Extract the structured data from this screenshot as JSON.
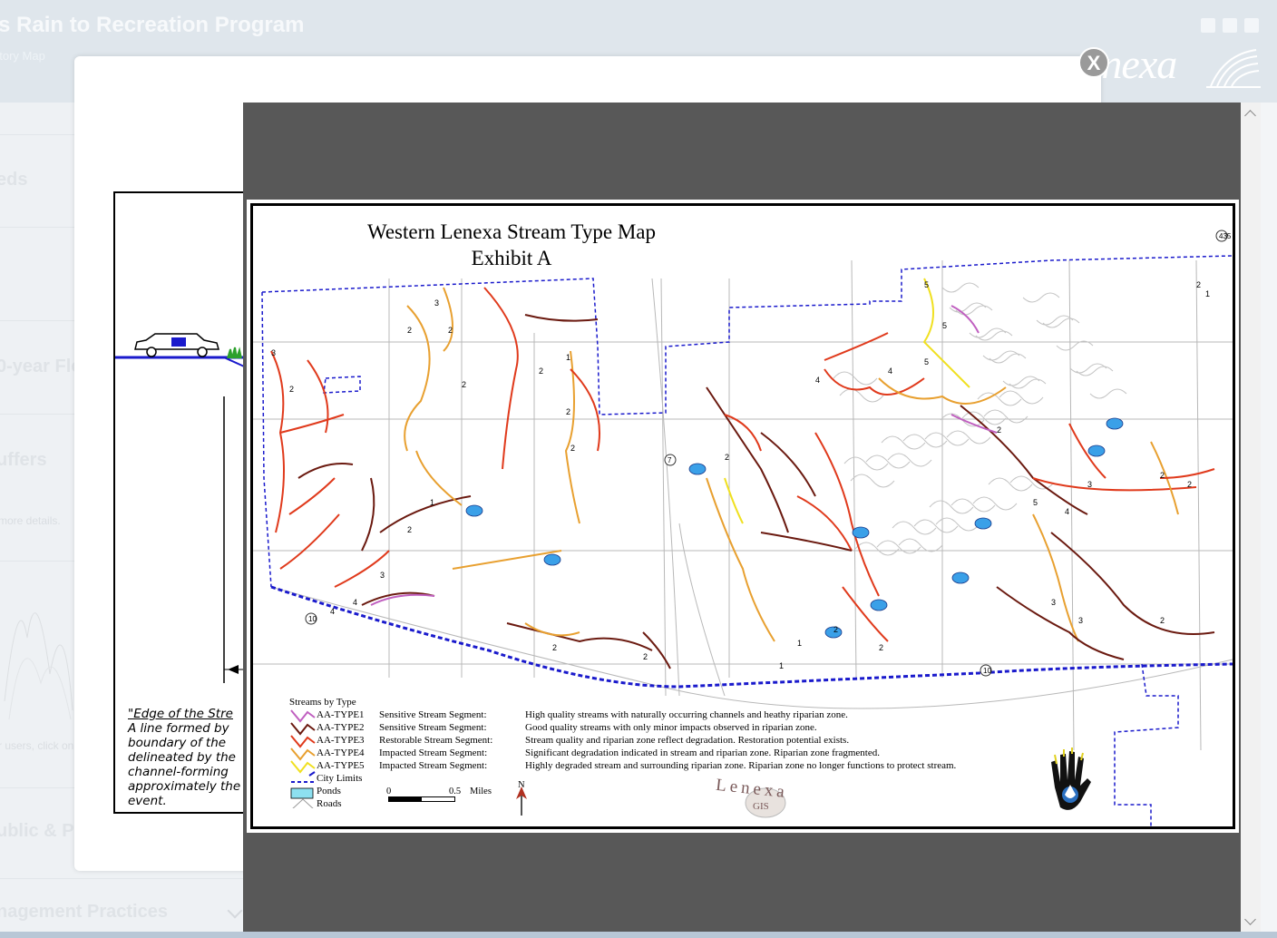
{
  "background": {
    "title": "s Rain to Recreation Program",
    "subtitle": "atory Map",
    "logo_text": "enexa",
    "sections": [
      "eds",
      "0-year Flo",
      "uffers",
      "ublic & P",
      "nagement Practices"
    ],
    "more_details": "more details.",
    "users_text": "r users, click on t"
  },
  "dialog": {
    "close_label": "X"
  },
  "schematic": {
    "note_title": "\"Edge of the Stre",
    "note_lines": [
      "A line formed by",
      "boundary of the",
      "delineated by the",
      "channel-forming",
      "approximately the",
      "event."
    ]
  },
  "map": {
    "title_line1": "Western Lenexa Stream Type Map",
    "title_line2": "Exhibit A",
    "legend": {
      "heading": "Streams by Type",
      "types": [
        {
          "label": "AA-TYPE1",
          "category": "Sensitive Stream Segment:",
          "description": "High quality streams with naturally occurring channels and heathy riparian zone.",
          "color": "#c060c0"
        },
        {
          "label": "AA-TYPE2",
          "category": "Sensitive Stream Segment:",
          "description": "Good quality streams with only minor impacts observed in riparian zone.",
          "color": "#6b1a10"
        },
        {
          "label": "AA-TYPE3",
          "category": "Restorable Stream Segment:",
          "description": "Stream quality and riparian zone reflect degradation.  Restoration potential exists.",
          "color": "#e03a1c"
        },
        {
          "label": "AA-TYPE4",
          "category": "Impacted Stream Segment:",
          "description": "Significant degradation indicated in stream and riparian zone.  Riparian zone fragmented.",
          "color": "#e8a030"
        },
        {
          "label": "AA-TYPE5",
          "category": "Impacted Stream Segment:",
          "description": "Highly degraded stream and surrounding riparian zone.  Riparian zone no longer functions to protect stream.",
          "color": "#f0e020"
        }
      ],
      "city_limits": "City Limits",
      "ponds": "Ponds",
      "roads": "Roads",
      "city_limits_color": "#1a1acc",
      "pond_color": "#3aa0e8"
    },
    "scale": {
      "start": "0",
      "end": "0.5",
      "unit": "Miles"
    },
    "north": "N",
    "gis_logo": "Lenexa",
    "gis_sub": "GIS",
    "highway_markers": [
      "7",
      "10",
      "10",
      "435"
    ],
    "segment_labels": [
      "1",
      "2",
      "3",
      "4",
      "5"
    ]
  }
}
